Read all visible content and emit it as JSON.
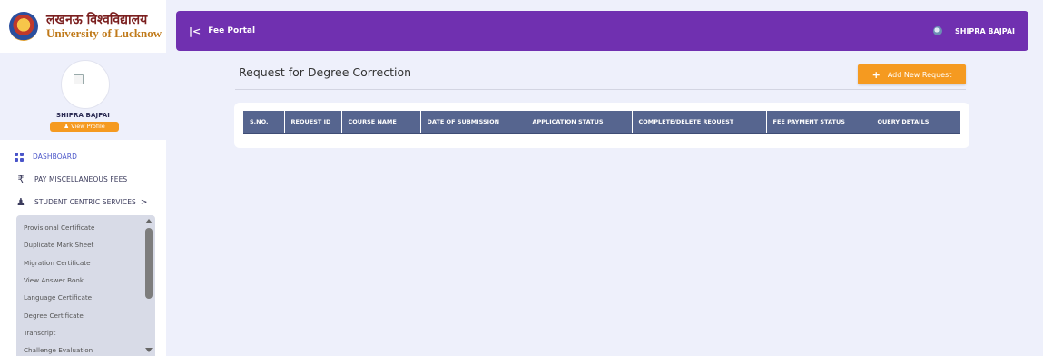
{
  "logo": {
    "hindi_name": "लखनऊ विश्वविद्यालय",
    "english_name": "University of Lucknow"
  },
  "profile": {
    "name": "SHIPRA BAJPAI",
    "view_profile_label": "View Profile",
    "view_profile_icon": "user-icon"
  },
  "menu": {
    "items": [
      {
        "label": "DASHBOARD",
        "icon": "dashboard-grid-icon",
        "active": true
      },
      {
        "label": "PAY MISCELLANEOUS FEES",
        "icon": "rupee-icon",
        "active": false
      },
      {
        "label": "STUDENT CENTRIC SERVICES",
        "icon": "student-icon",
        "active": false,
        "chevron": ">"
      }
    ],
    "submenu": [
      "Provisional Certificate",
      "Duplicate Mark Sheet",
      "Migration Certificate",
      "View Answer Book",
      "Language Certificate",
      "Degree Certificate",
      "Transcript",
      "Challenge Evaluation"
    ]
  },
  "header": {
    "collapse_icon": "|<",
    "title": "Fee Portal",
    "user_name": "SHIPRA BAJPAI"
  },
  "main": {
    "page_title": "Request for Degree Correction",
    "add_button_label": "Add New Request",
    "add_button_icon": "+",
    "table_headers": [
      "S.NO.",
      "REQUEST ID",
      "COURSE NAME",
      "DATE OF SUBMISSION",
      "APPLICATION STATUS",
      "COMPLETE/DELETE REQUEST",
      "FEE PAYMENT STATUS",
      "QUERY DETAILS"
    ],
    "rows": []
  },
  "colors": {
    "header_bg": "#7030b0",
    "accent_orange": "#f59a20",
    "table_header_bg": "#56658f",
    "active_menu": "#4a55c9",
    "page_bg": "#eef0fb"
  }
}
